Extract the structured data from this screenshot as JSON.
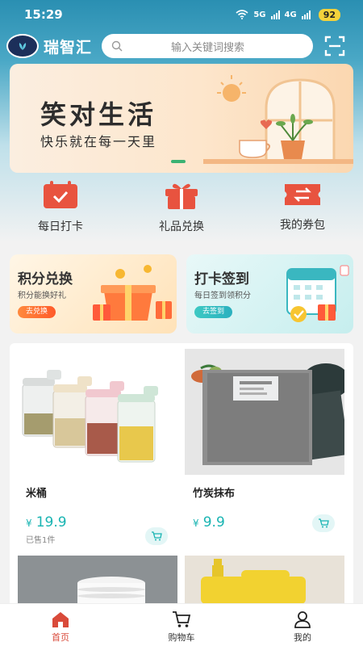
{
  "status_bar": {
    "time": "15:29",
    "network": "5G",
    "network2": "4G",
    "battery": "92"
  },
  "header": {
    "app_name": "瑞智汇",
    "logo_text": "瑞智汇",
    "search_placeholder": "输入关键词搜索"
  },
  "banner": {
    "title": "笑对生活",
    "subtitle": "快乐就在每一天里"
  },
  "quick_actions": [
    {
      "label": "每日打卡",
      "icon": "calendar-check-icon"
    },
    {
      "label": "礼品兑换",
      "icon": "gift-icon"
    },
    {
      "label": "我的券包",
      "icon": "coupon-icon"
    }
  ],
  "promos": {
    "left": {
      "title": "积分兑换",
      "subtitle": "积分能换好礼",
      "button": "去兑换"
    },
    "right": {
      "title": "打卡签到",
      "subtitle": "每日签到领积分",
      "button": "去签到"
    }
  },
  "products": [
    {
      "name": "米桶",
      "currency": "¥",
      "price": "19.9",
      "sold": "已售1件"
    },
    {
      "name": "竹炭抹布",
      "currency": "¥",
      "price": "9.9",
      "sold": ""
    }
  ],
  "tabbar": [
    {
      "label": "首页",
      "icon": "home-icon",
      "active": true
    },
    {
      "label": "购物车",
      "icon": "cart-icon",
      "active": false
    },
    {
      "label": "我的",
      "icon": "user-icon",
      "active": false
    }
  ],
  "colors": {
    "accent": "#18b4b2",
    "brand_red": "#e8533f",
    "active_tab": "#d94a3a"
  }
}
